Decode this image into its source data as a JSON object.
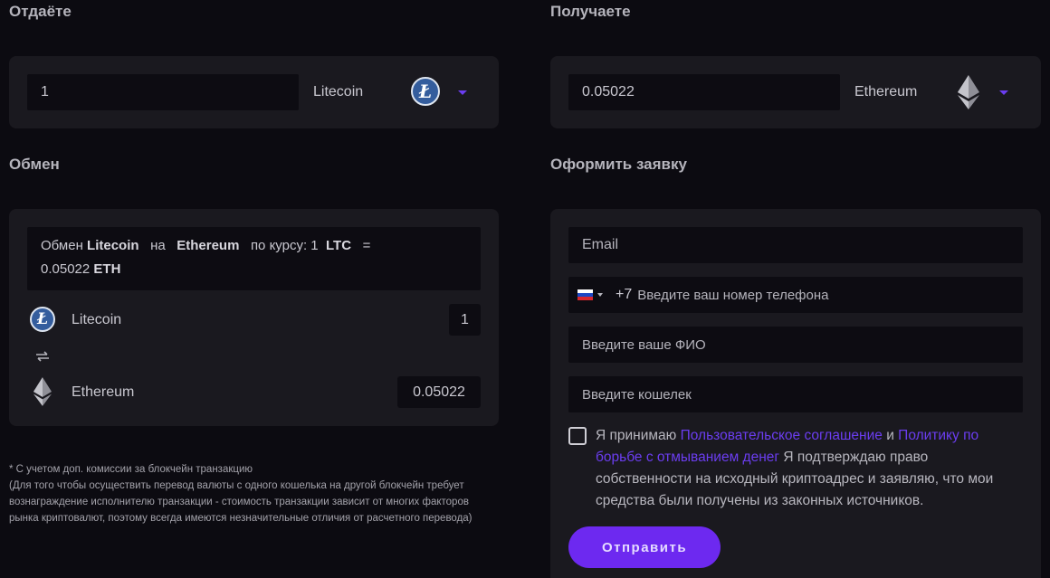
{
  "give": {
    "title": "Отдаёте",
    "amount": "1",
    "coin": "Litecoin",
    "icon": "litecoin-icon"
  },
  "receive": {
    "title": "Получаете",
    "amount": "0.05022",
    "coin": "Ethereum",
    "icon": "ethereum-icon"
  },
  "exchange": {
    "title": "Обмен",
    "rate_prefix": "Обмен",
    "from_coin": "Litecoin",
    "to_word": "на",
    "to_coin": "Ethereum",
    "rate_label": "по курсу: 1",
    "from_ticker": "LTC",
    "equals": "=",
    "rate_value": "0.05022",
    "to_ticker": "ETH",
    "row1_coin": "Litecoin",
    "row1_amount": "1",
    "swap_icon": "swap-icon",
    "row2_coin": "Ethereum",
    "row2_amount": "0.05022"
  },
  "note": {
    "line1": "* С учетом доп. комиссии за блокчейн транзакцию",
    "line2": "(Для того чтобы осуществить перевод валюты с одного кошелька на другой блокчейн требует",
    "line3": "вознаграждение исполнителю транзакции - стоимость транзакции зависит от многих факторов",
    "line4": "рынка криптовалют, поэтому всегда имеются незначительные отличия от расчетного перевода)"
  },
  "order": {
    "title": "Оформить заявку",
    "email_placeholder": "Email",
    "phone_code": "+7",
    "phone_placeholder": "Введите ваш номер телефона",
    "name_placeholder": "Введите ваше ФИО",
    "wallet_placeholder": "Введите кошелек",
    "agree_prefix": "Я принимаю",
    "agree_link1": "Пользовательское соглашение",
    "agree_and": "и",
    "agree_link2": "Политику по борьбе с отмыванием денег",
    "agree_suffix": "Я подтверждаю право собственности на исходный криптоадрес и заявляю, что мои средства были получены из законных источников.",
    "submit_label": "Отправить"
  },
  "colors": {
    "accent": "#6d29f0",
    "background": "#0c0b11",
    "card": "#1a191f"
  }
}
